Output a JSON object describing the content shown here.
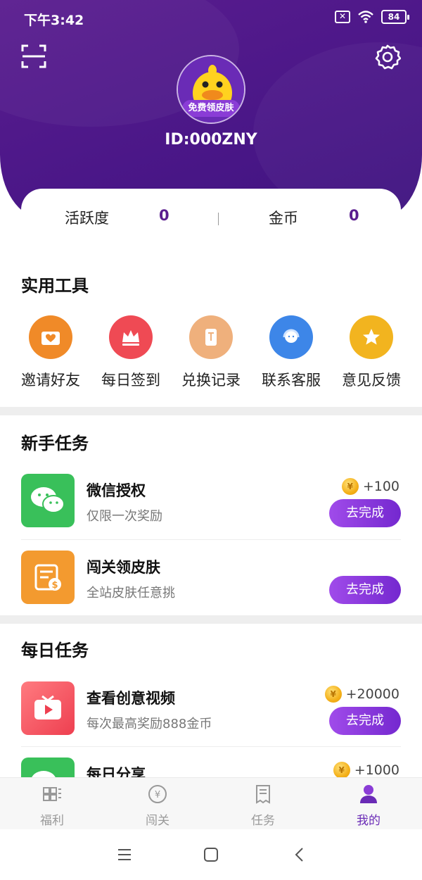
{
  "status_bar": {
    "time": "下午3:42",
    "battery": "84"
  },
  "profile": {
    "avatar_tag": "免费领皮肤",
    "user_id": "ID:000ZNY"
  },
  "stats": [
    {
      "label": "活跃度",
      "value": "0"
    },
    {
      "label": "金币",
      "value": "0"
    }
  ],
  "tools_section": {
    "title": "实用工具",
    "items": [
      {
        "label": "邀请好友",
        "icon": "invite-envelope-icon",
        "color": "#f08a28"
      },
      {
        "label": "每日签到",
        "icon": "crown-checkin-icon",
        "color": "#ef4a54"
      },
      {
        "label": "兑换记录",
        "icon": "ticket-record-icon",
        "color": "#efb07c"
      },
      {
        "label": "联系客服",
        "icon": "customer-service-icon",
        "color": "#3d86e8"
      },
      {
        "label": "意见反馈",
        "icon": "star-feedback-icon",
        "color": "#f2b41f"
      }
    ]
  },
  "newbie_section": {
    "title": "新手任务",
    "tasks": [
      {
        "title": "微信授权",
        "desc": "仅限一次奖励",
        "reward": "+100",
        "button": "去完成",
        "icon": "wechat-icon",
        "color": "#39c05a"
      },
      {
        "title": "闯关领皮肤",
        "desc": "全站皮肤任意挑",
        "reward": "",
        "button": "去完成",
        "icon": "coin-bill-icon",
        "color": "#f39a2f"
      }
    ]
  },
  "daily_section": {
    "title": "每日任务",
    "tasks": [
      {
        "title": "查看创意视频",
        "desc": "每次最高奖励888金币",
        "reward": "+20000",
        "button": "去完成",
        "icon": "video-play-icon",
        "color": "#f0525e"
      },
      {
        "title": "每日分享",
        "desc": "",
        "reward": "+1000",
        "button": "",
        "icon": "wechat-icon",
        "color": "#39c05a"
      }
    ]
  },
  "bottom_nav": {
    "items": [
      {
        "label": "福利",
        "icon": "gift-grid-icon",
        "active": false
      },
      {
        "label": "闯关",
        "icon": "yuan-coin-icon",
        "active": false
      },
      {
        "label": "任务",
        "icon": "task-list-icon",
        "active": false
      },
      {
        "label": "我的",
        "icon": "profile-icon",
        "active": true
      }
    ]
  },
  "colors": {
    "brand_purple": "#5a1d8f",
    "button_gradient_start": "#a04bea",
    "button_gradient_end": "#7428cf"
  }
}
